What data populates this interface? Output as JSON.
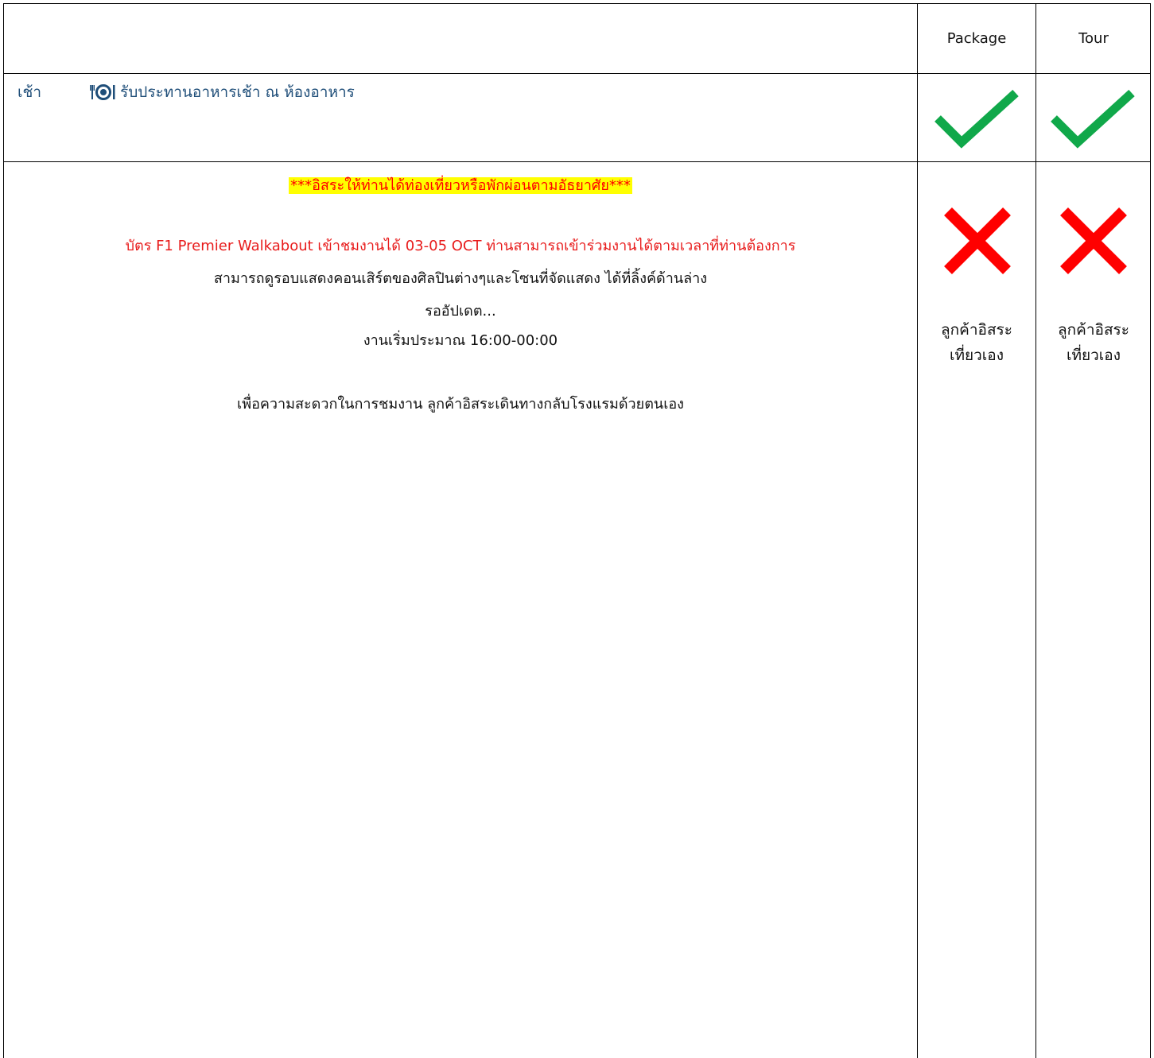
{
  "columns": {
    "package": "Package",
    "tour": "Tour"
  },
  "breakfast": {
    "time": "เช้า",
    "icon": "plate-cutlery-icon",
    "text": "รับประทานอาหารเช้า ณ ห้องอาหาร",
    "package_included": true,
    "tour_included": true
  },
  "free_day": {
    "headline": "***อิสระให้ท่านได้ท่องเที่ยวหรือพักผ่อนตามอัธยาศัย***",
    "ticket_line": "บัตร F1 Premier Walkabout เข้าชมงานได้ 03-05 OCT ท่านสามารถเข้าร่วมงานได้ตามเวลาที่ท่านต้องการ",
    "concert_line": "สามารถดูรอบแสดงคอนเสิร์ตของศิลปินต่างๆและโซนที่จัดแสดง ได้ที่ลิ้งค์ด้านล่าง",
    "update_line": "รออัปเดต...",
    "time_line": "งานเริ่มประมาณ 16:00-00:00",
    "return_line": "เพื่อความสะดวกในการชมงาน ลูกค้าอิสระเดินทางกลับโรงแรมด้วยตนเอง",
    "package_included": false,
    "tour_included": false,
    "package_note_1": "ลูกค้าอิสระ",
    "package_note_2": "เที่ยวเอง",
    "tour_note_1": "ลูกค้าอิสระ",
    "tour_note_2": "เที่ยวเอง"
  },
  "colors": {
    "check": "#10a84a",
    "cross": "#ff0000",
    "meal_text": "#1f4e79",
    "highlight": "#ffff00"
  }
}
